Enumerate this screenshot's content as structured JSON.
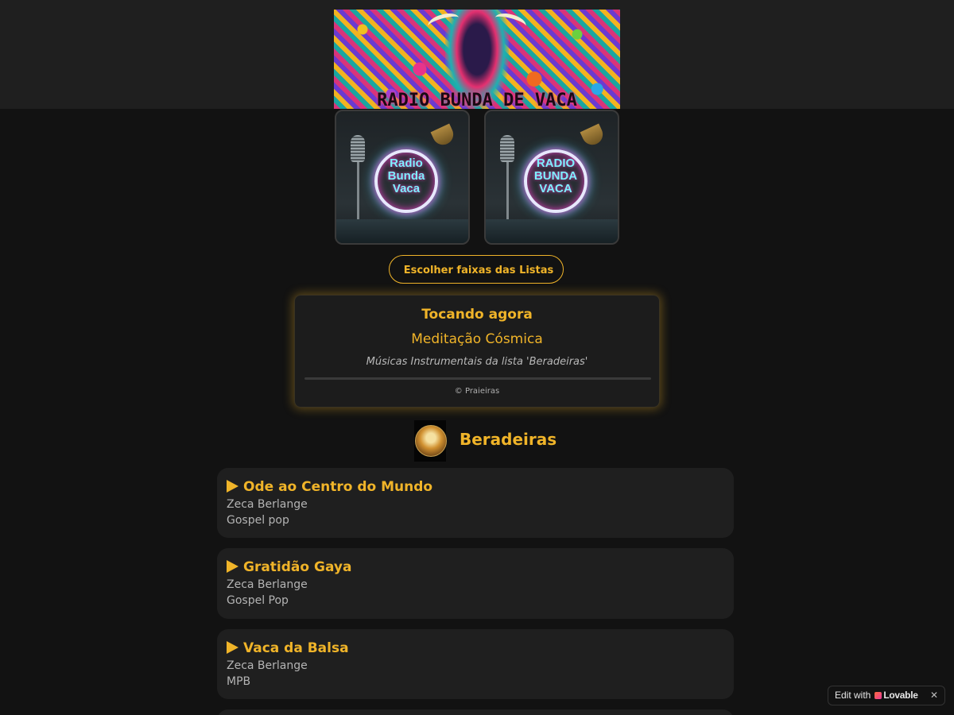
{
  "banner": {
    "title": "RADIO BUNDA DE VACA"
  },
  "covers": [
    {
      "lines": [
        "Radio",
        "Bunda",
        "Vaca"
      ]
    },
    {
      "lines": [
        "RADIO",
        "BUNDA",
        "VACA"
      ]
    }
  ],
  "choose_button": {
    "label": "Escolher faixas das Listas"
  },
  "now_playing": {
    "heading": "Tocando agora",
    "track": "Meditação Cósmica",
    "subtitle": "Músicas Instrumentais da lista 'Beradeiras'",
    "copyright": "© Praieiras",
    "progress": 0
  },
  "playlist": {
    "title": "Beradeiras",
    "tracks": [
      {
        "title": "Ode ao Centro do Mundo",
        "artist": "Zeca Berlange",
        "genre": "Gospel pop"
      },
      {
        "title": "Gratidão Gaya",
        "artist": "Zeca Berlange",
        "genre": "Gospel Pop"
      },
      {
        "title": "Vaca da Balsa",
        "artist": "Zeca Berlange",
        "genre": "MPB"
      }
    ]
  },
  "badge": {
    "prefix": "Edit with",
    "brand": "Lovable",
    "close": "✕"
  },
  "colors": {
    "accent": "#f0b429",
    "background": "#121212",
    "card": "#1f1f1f"
  },
  "icons": {
    "play": "play-icon",
    "close": "close-icon",
    "brand": "lovable-heart-icon"
  }
}
